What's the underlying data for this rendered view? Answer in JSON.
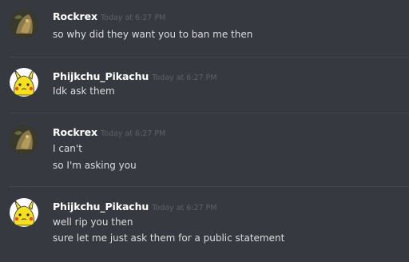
{
  "messages": [
    {
      "author": "Rockrex",
      "timestamp": "Today at 6:27 PM",
      "avatar_icon": "rockrex-avatar-icon",
      "lines": [
        "so why did they want you to ban me then"
      ]
    },
    {
      "author": "Phijkchu_Pikachu",
      "timestamp": "Today at 6:27 PM",
      "avatar_icon": "pikachu-avatar-icon",
      "lines": [
        "Idk ask them"
      ]
    },
    {
      "author": "Rockrex",
      "timestamp": "Today at 6:27 PM",
      "avatar_icon": "rockrex-avatar-icon",
      "lines": [
        "I can't",
        "so I'm asking you"
      ]
    },
    {
      "author": "Phijkchu_Pikachu",
      "timestamp": "Today at 6:27 PM",
      "avatar_icon": "pikachu-avatar-icon",
      "lines": [
        "well rip you then",
        "sure let me just ask them for a public statement"
      ]
    }
  ],
  "colors": {
    "background": "#36393f",
    "divider": "#42454a",
    "username": "#ffffff",
    "timestamp": "#5e6167",
    "message_text": "#dcddde",
    "pikachu_yellow": "#f5e11a",
    "rockrex_dark": "#2f2a22"
  }
}
